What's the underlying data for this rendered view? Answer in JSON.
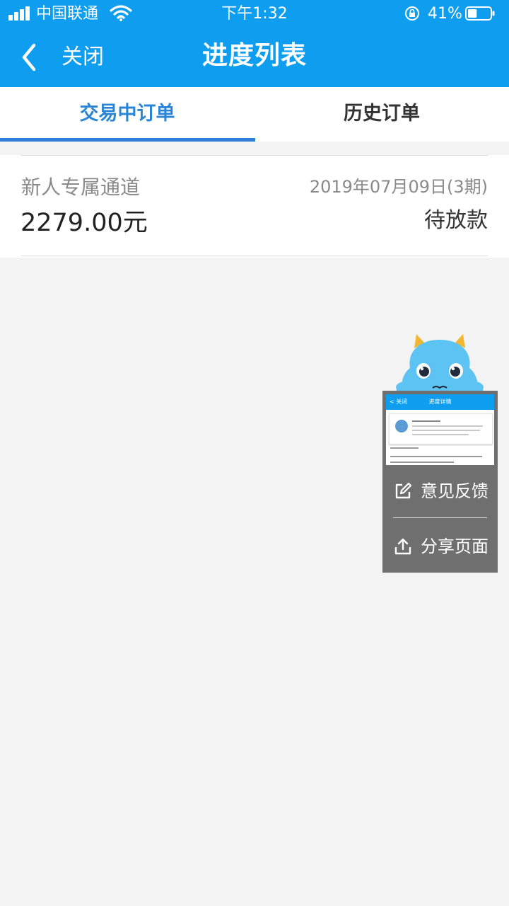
{
  "status_bar": {
    "carrier": "中国联通",
    "time": "下午1:32",
    "battery_percent": "41%",
    "battery_level": 0.41,
    "icons": [
      "signal-icon",
      "wifi-icon",
      "rotation-lock-icon",
      "battery-icon"
    ]
  },
  "nav": {
    "back_icon": "chevron-left-icon",
    "back_label": "关闭",
    "title": "进度列表"
  },
  "tabs": {
    "active_label": "交易中订单",
    "inactive_label": "历史订单"
  },
  "orders": [
    {
      "name": "新人专属通道",
      "amount": "2279.00元",
      "date": "2019年07月09日(3期)",
      "status": "待放款"
    }
  ],
  "feedback_widget": {
    "mascot_icon": "blue-monster-mascot-icon",
    "thumbnail": {
      "back_label": "< 关闭",
      "title": "进度详情"
    },
    "feedback_label": "意见反馈",
    "feedback_icon": "edit-icon",
    "share_label": "分享页面",
    "share_icon": "share-icon"
  },
  "colors": {
    "header_blue": "#0f9df0",
    "tab_active": "#2a86d4",
    "page_background": "#f3f3f3",
    "widget_gray": "#6f6f6f",
    "mascot_blue": "#5cc3f2"
  }
}
